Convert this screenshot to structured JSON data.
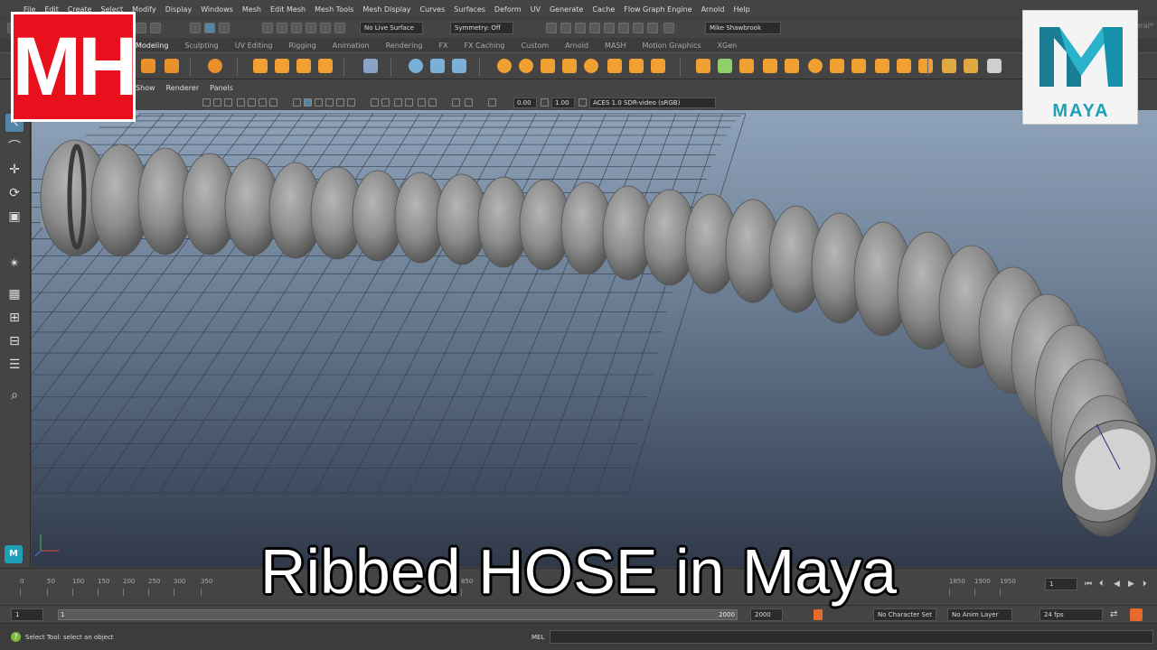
{
  "menubar": {
    "items": [
      "File",
      "Edit",
      "Create",
      "Select",
      "Modify",
      "Display",
      "Windows",
      "Mesh",
      "Edit Mesh",
      "Mesh Tools",
      "Mesh Display",
      "Curves",
      "Surfaces",
      "Deform",
      "UV",
      "Generate",
      "Cache",
      "Flow Graph Engine",
      "Arnold",
      "Help"
    ],
    "workspace": "Workspace: General*"
  },
  "statusline": {
    "live_surface": "No Live Surface",
    "symmetry": "Symmetry: Off",
    "user": "Mike Shawbrook"
  },
  "shelf": {
    "tabs": [
      "Modeling",
      "Sculpting",
      "UV Editing",
      "Rigging",
      "Animation",
      "Rendering",
      "FX",
      "FX Caching",
      "Custom",
      "Arnold",
      "MASH",
      "Motion Graphics",
      "XGen"
    ],
    "active_tab": "Modeling"
  },
  "panel": {
    "menus": [
      "Show",
      "Renderer",
      "Panels"
    ],
    "exposure": "0.00",
    "gamma": "1.00",
    "color_space": "ACES 1.0 SDR-video (sRGB)"
  },
  "timeline": {
    "ticks": [
      "0",
      "50",
      "100",
      "150",
      "200",
      "250",
      "300",
      "350",
      "850",
      "1850",
      "1900",
      "1950"
    ],
    "current_frame": "1",
    "range_start": "1",
    "range_start_inner": "1",
    "range_end": "2000",
    "anim_end": "2000",
    "character_set": "No Character Set",
    "anim_layer": "No Anim Layer",
    "fps": "24 fps"
  },
  "helpline": {
    "text": "Select Tool: select an object",
    "mel_label": "MEL"
  },
  "overlay": {
    "mh_logo_text": "MH",
    "maya_logo_text": "MAYA",
    "title": "Ribbed HOSE in Maya"
  },
  "colors": {
    "ui_bg": "#444444",
    "accent": "#5285a6",
    "mh_red": "#e8101c",
    "maya_teal": "#1fa0b9"
  }
}
